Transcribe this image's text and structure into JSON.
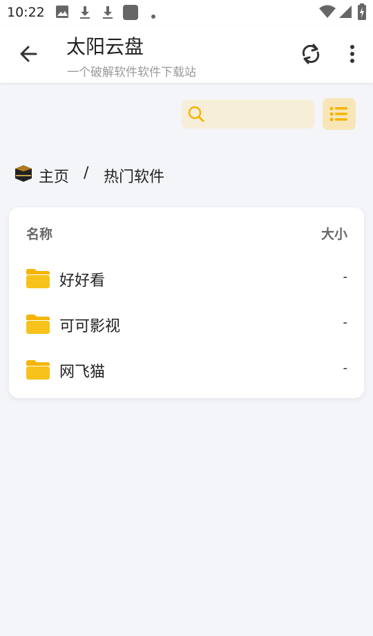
{
  "status_bar": {
    "time": "10:22"
  },
  "app_bar": {
    "title": "太阳云盘",
    "subtitle": "一个破解软件软件下载站"
  },
  "search": {
    "placeholder": "",
    "value": ""
  },
  "breadcrumb": {
    "home": "主页",
    "separator": "/",
    "current": "热门软件"
  },
  "file_list": {
    "header_name": "名称",
    "header_size": "大小",
    "items": [
      {
        "name": "好好看",
        "size": "-"
      },
      {
        "name": "可可影视",
        "size": "-"
      },
      {
        "name": "网飞猫",
        "size": "-"
      }
    ]
  },
  "colors": {
    "accent": "#f5b400",
    "search_bg": "#f6eed8",
    "toggle_bg": "#f8e6b8",
    "page_bg": "#f4f5f9"
  }
}
